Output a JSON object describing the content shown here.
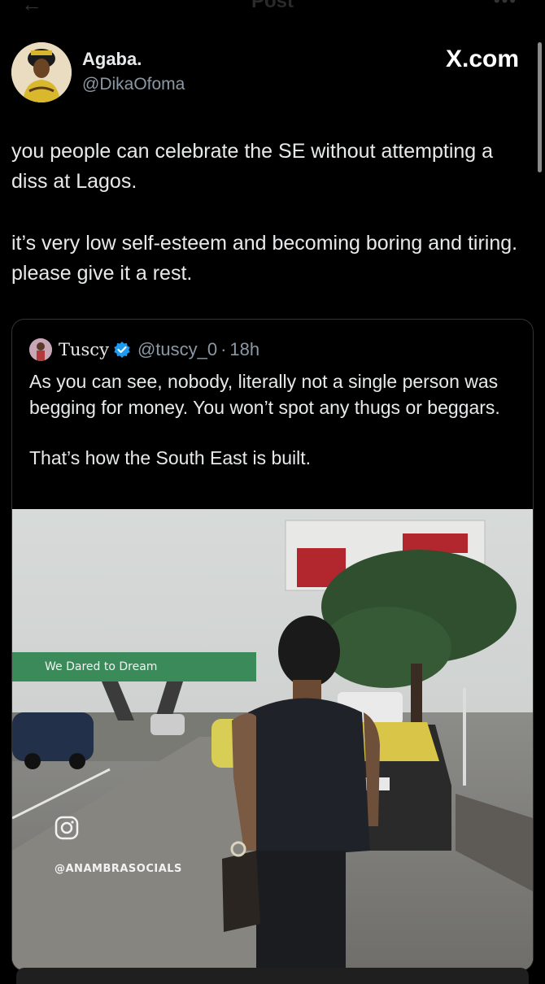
{
  "topbar": {
    "back_icon": "←",
    "title": "Post",
    "more_icon": "•••"
  },
  "author": {
    "name": "Agaba.",
    "handle": "@DikaOfoma",
    "avatar_icon": "avatar-photo"
  },
  "brand": {
    "logo_text": "X.com"
  },
  "post": {
    "paragraphs": [
      "you people can celebrate the SE without attempting a diss at Lagos.",
      "it’s very low self-esteem and becoming boring and tiring. please give it a rest."
    ]
  },
  "quoted": {
    "name": "Tuscy",
    "handle": "@tuscy_0",
    "separator": "·",
    "time": "18h",
    "paragraphs": [
      "As you can see, nobody, literally not a single person was begging for money. You won’t spot any thugs or beggars.",
      "That’s how the South East is built."
    ],
    "media": {
      "bridge_sign": "We Dared to Dream",
      "watermark": "@ANAMBRASOCIALS",
      "watermark_icon": "instagram-icon"
    }
  },
  "colors": {
    "background": "#000000",
    "text": "#e7e9ea",
    "muted": "#8b98a5",
    "verified": "#1d9bf0",
    "border": "#333333"
  }
}
